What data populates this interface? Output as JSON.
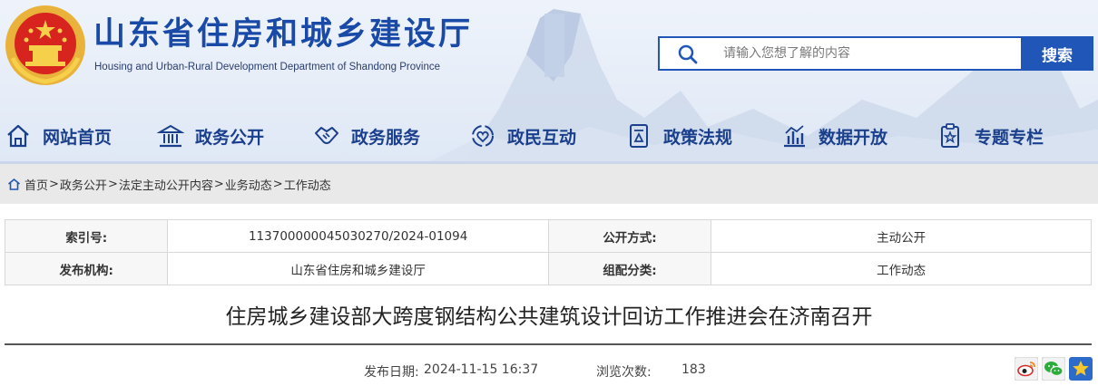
{
  "header": {
    "site_title": "山东省住房和城乡建设厅",
    "site_subtitle": "Housing and Urban-Rural Development Department of Shandong Province",
    "emblem_icon": "national-emblem-icon"
  },
  "search": {
    "placeholder": "请输入您想了解的内容",
    "button_label": "搜索",
    "icon": "search-icon"
  },
  "nav": {
    "items": [
      {
        "label": "网站首页",
        "icon": "home-icon"
      },
      {
        "label": "政务公开",
        "icon": "government-building-icon"
      },
      {
        "label": "政务服务",
        "icon": "handshake-icon"
      },
      {
        "label": "政民互动",
        "icon": "interaction-heart-icon"
      },
      {
        "label": "政策法规",
        "icon": "document-icon"
      },
      {
        "label": "数据开放",
        "icon": "bar-chart-icon"
      },
      {
        "label": "专题专栏",
        "icon": "star-document-icon"
      }
    ]
  },
  "breadcrumb": {
    "items": [
      "首页",
      "政务公开",
      "法定主动公开内容",
      "业务动态",
      "工作动态"
    ],
    "separator": ">"
  },
  "info_table": {
    "index_label": "索引号:",
    "index_value": "113700000045030270/2024-01094",
    "publish_method_label": "公开方式:",
    "publish_method_value": "主动公开",
    "publisher_label": "发布机构:",
    "publisher_value": "山东省住房和城乡建设厅",
    "category_label": "组配分类:",
    "category_value": "工作动态"
  },
  "article": {
    "title": "住房城乡建设部大跨度钢结构公共建筑设计回访工作推进会在济南召开",
    "publish_date_label": "发布日期:",
    "publish_date": "2024-11-15 16:37",
    "views_label": "浏览次数:",
    "views": "183"
  },
  "share": {
    "icons": [
      "weibo-icon",
      "wechat-icon",
      "favorite-star-icon"
    ]
  },
  "colors": {
    "brand_blue": "#1f56b8",
    "title_blue": "#1a4aa8",
    "nav_text": "#1a3f8c"
  }
}
